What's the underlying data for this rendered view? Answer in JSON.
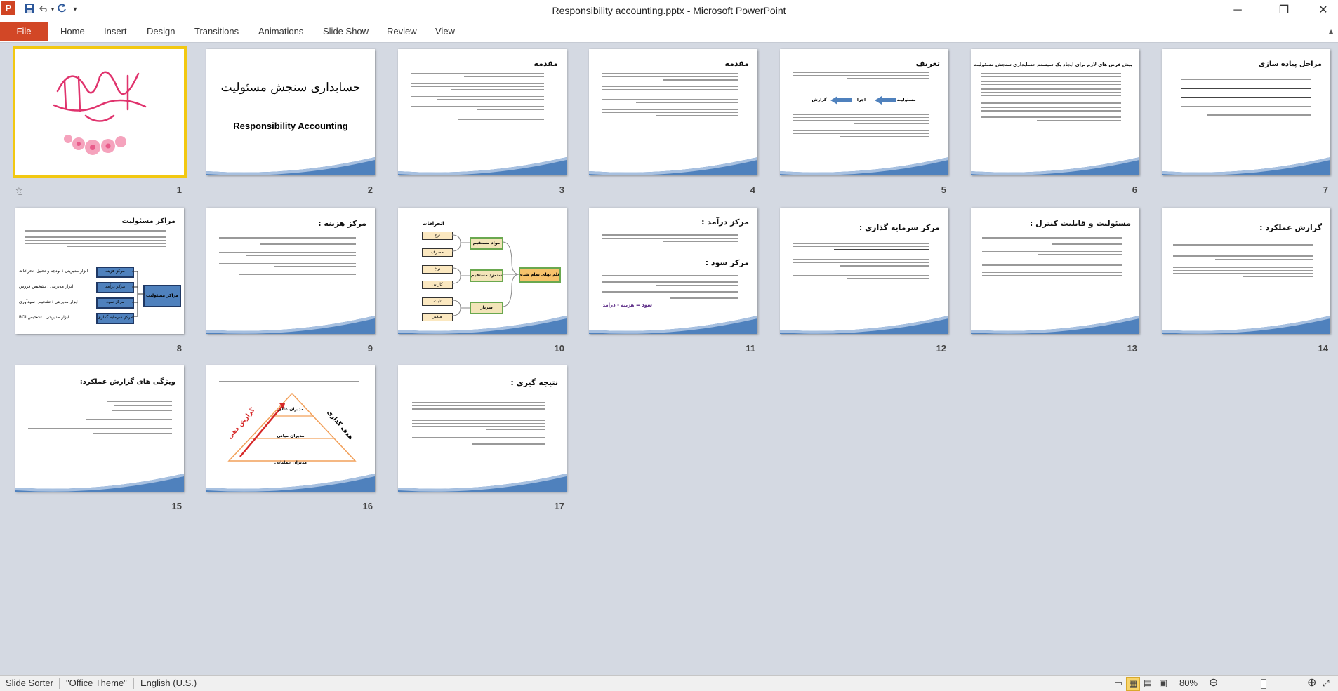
{
  "window": {
    "title": "Responsibility accounting.pptx - Microsoft PowerPoint",
    "app_letter": "P"
  },
  "qat": {
    "save_icon": "save-icon",
    "undo_icon": "undo-icon",
    "redo_icon": "redo-icon",
    "customize_icon": "customize-icon"
  },
  "controls": {
    "minimize": "─",
    "restore": "❐",
    "close": "✕"
  },
  "ribbon": {
    "file": "File",
    "tabs": [
      "Home",
      "Insert",
      "Design",
      "Transitions",
      "Animations",
      "Slide Show",
      "Review",
      "View"
    ]
  },
  "slides": [
    {
      "num": "1",
      "title": ""
    },
    {
      "num": "2",
      "title": "حسابداری سنجش مسئولیت",
      "subtitle": "Responsibility Accounting"
    },
    {
      "num": "3",
      "title": "مقدمه"
    },
    {
      "num": "4",
      "title": "مقدمه"
    },
    {
      "num": "5",
      "title": "تعریف",
      "diagram": [
        "مسئولیت",
        "اجرا",
        "گزارش"
      ]
    },
    {
      "num": "6",
      "title": "پیش فرض های لازم برای ایجاد یک سیستم حسابداری سنجش مسئولیت"
    },
    {
      "num": "7",
      "title": "مراحل پیاده سازی"
    },
    {
      "num": "8",
      "title": "مراکز مسئولیت",
      "center": "مراکز مسئولیت",
      "boxes": [
        "مرکز هزینه",
        "مرکز درآمد",
        "مرکز سود",
        "مرکز سرمایه گذاری"
      ],
      "labels": [
        "ابزار مدیریتی : بودجه و تحلیل انحرافات",
        "ابزار مدیریتی : تشخیص فروش",
        "ابزار مدیریتی : تشخیص سودآوری",
        "ابزار مدیریتی : تشخیص ROI"
      ]
    },
    {
      "num": "9",
      "title": "مرکز هزینه :"
    },
    {
      "num": "10",
      "title": "",
      "header": "انحرافات",
      "left": [
        "نرخ",
        "مصرف",
        "نرخ",
        "کارایی",
        "ثابت",
        "متغیر"
      ],
      "mid": [
        "مواد مستقیم",
        "دستمزد مستقیم",
        "سربار"
      ],
      "right": "قلم بهای تمام شده"
    },
    {
      "num": "11",
      "title": "مرکز درآمد :",
      "title2": "مرکز سود :",
      "formula": "سود = هزینه - درآمد"
    },
    {
      "num": "12",
      "title": "مرکز سرمایه گذاری :"
    },
    {
      "num": "13",
      "title": "مسئولیت و قابلیت کنترل :"
    },
    {
      "num": "14",
      "title": "گزارش عملکرد :"
    },
    {
      "num": "15",
      "title": "ویژگی های گزارش عملکرد:"
    },
    {
      "num": "16",
      "title": "",
      "levels": [
        "مدیران عالی",
        "مدیران میانی",
        "مدیران عملیاتی"
      ],
      "left_label": "گزارش دهی",
      "right_label": "هدف گذاری"
    },
    {
      "num": "17",
      "title": "نتیجه گیری :"
    }
  ],
  "status": {
    "view": "Slide Sorter",
    "theme": "\"Office Theme\"",
    "language": "English (U.S.)",
    "zoom": "80%",
    "zoom_value": 0.5
  },
  "colors": {
    "file_tab": "#d24726",
    "selection": "#f2c811",
    "accent_blue": "#4f81bd"
  }
}
